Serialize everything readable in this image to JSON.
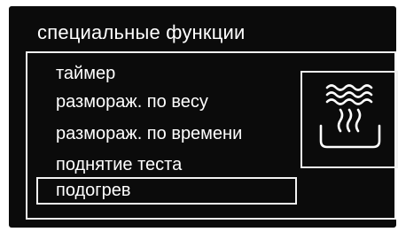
{
  "screen": {
    "title": "специальные функции"
  },
  "menu": {
    "items": [
      {
        "label": "таймер",
        "selected": false
      },
      {
        "label": "размораж. по весу",
        "selected": false
      },
      {
        "label": "размораж. по времени",
        "selected": false
      },
      {
        "label": "поднятие теста",
        "selected": false
      },
      {
        "label": "подогрев",
        "selected": true
      }
    ]
  },
  "preview": {
    "icon": "reheat-steam-bowl-icon"
  },
  "colors": {
    "background": "#0b0b0b",
    "foreground": "#ffffff"
  }
}
